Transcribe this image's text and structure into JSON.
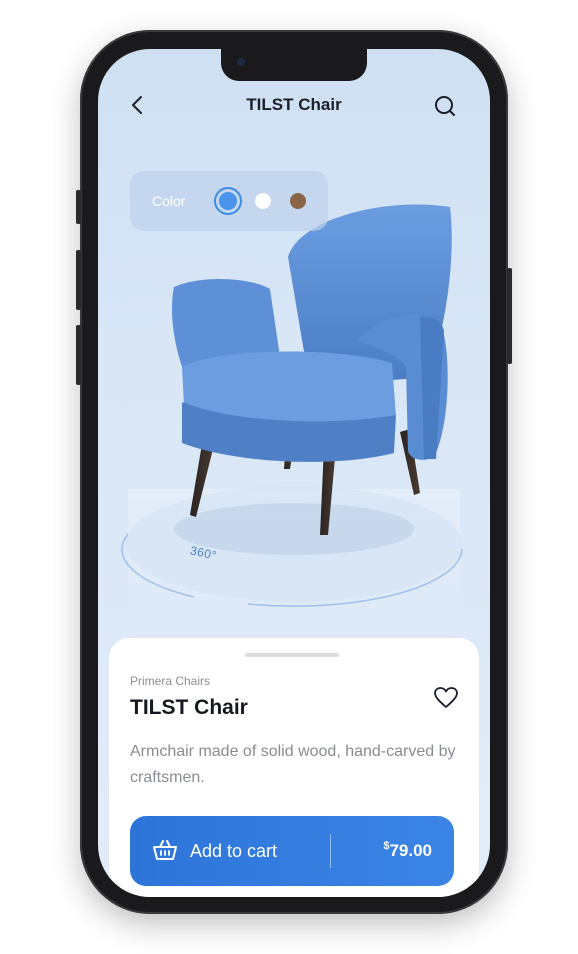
{
  "header": {
    "title": "TILST Chair",
    "back_icon": "chevron-left-icon",
    "search_icon": "search-icon"
  },
  "color_picker": {
    "label": "Color",
    "options": [
      {
        "name": "blue",
        "color": "#4a94ec",
        "selected": true
      },
      {
        "name": "white",
        "color": "#ffffff",
        "selected": false
      },
      {
        "name": "brown",
        "color": "#8a6446",
        "selected": false
      }
    ]
  },
  "viewer": {
    "rotate_label": "360°"
  },
  "product": {
    "brand": "Primera Chairs",
    "name": "TILST Chair",
    "description": "Armchair made of solid wood, hand-carved by craftsmen.",
    "favorite_icon": "heart-icon"
  },
  "cart": {
    "label": "Add to cart",
    "currency": "$",
    "price": "79.00",
    "icon": "basket-icon"
  },
  "colors": {
    "accent": "#2d74d8",
    "background": "#d8e6f6",
    "chair": "#5b8fd6"
  }
}
